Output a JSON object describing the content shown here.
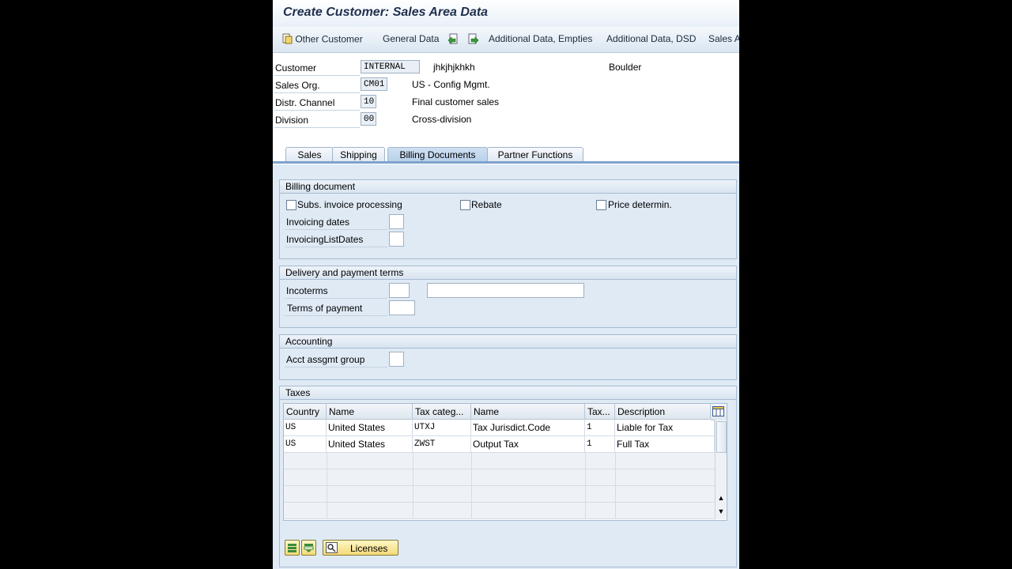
{
  "window": {
    "title": "Create Customer: Sales Area Data"
  },
  "toolbar": {
    "other_customer": "Other Customer",
    "general_data": "General Data",
    "additional_empties": "Additional Data, Empties",
    "additional_dsd": "Additional Data, DSD",
    "sales_area_truncated": "Sales A"
  },
  "header": {
    "customer": {
      "label": "Customer",
      "value": "INTERNAL",
      "name": "jhkjhjkhkh",
      "city": "Boulder"
    },
    "sales_org": {
      "label": "Sales Org.",
      "value": "CM01",
      "desc": "US - Config Mgmt."
    },
    "distr_channel": {
      "label": "Distr. Channel",
      "value": "10",
      "desc": "Final customer sales"
    },
    "division": {
      "label": "Division",
      "value": "00",
      "desc": "Cross-division"
    }
  },
  "tabs": [
    {
      "label": "Sales",
      "active": false
    },
    {
      "label": "Shipping",
      "active": false
    },
    {
      "label": "Billing Documents",
      "active": true
    },
    {
      "label": "Partner Functions",
      "active": false
    }
  ],
  "billing": {
    "title": "Billing document",
    "subs_invoice": "Subs. invoice processing",
    "rebate": "Rebate",
    "price_determ": "Price determin.",
    "invoicing_dates": "Invoicing dates",
    "invoicing_list_dates": "InvoicingListDates"
  },
  "delivery": {
    "title": "Delivery and payment terms",
    "incoterms": "Incoterms",
    "terms_of_payment": "Terms of payment"
  },
  "accounting": {
    "title": "Accounting",
    "acct_group": "Acct assgmt group"
  },
  "taxes": {
    "title": "Taxes",
    "columns": [
      "Country",
      "Name",
      "Tax categ...",
      "Name",
      "Tax...",
      "Description"
    ],
    "rows": [
      [
        "US",
        "United States",
        "UTXJ",
        "Tax Jurisdict.Code",
        "1",
        "Liable for Tax"
      ],
      [
        "US",
        "United States",
        "ZWST",
        "Output Tax",
        "1",
        "Full Tax"
      ]
    ],
    "licenses_label": "Licenses"
  },
  "colors": {
    "background": "#dfeaf5",
    "title": "#1f2f4e",
    "tab_active": "#b8d0ea",
    "button": "#f4d978"
  },
  "icons": [
    "other-customer-icon",
    "prev-screen-icon",
    "next-screen-icon",
    "table-settings-icon",
    "select-all-icon",
    "deselect-all-icon",
    "licenses-icon",
    "scroll-up-icon",
    "scroll-down-icon"
  ]
}
